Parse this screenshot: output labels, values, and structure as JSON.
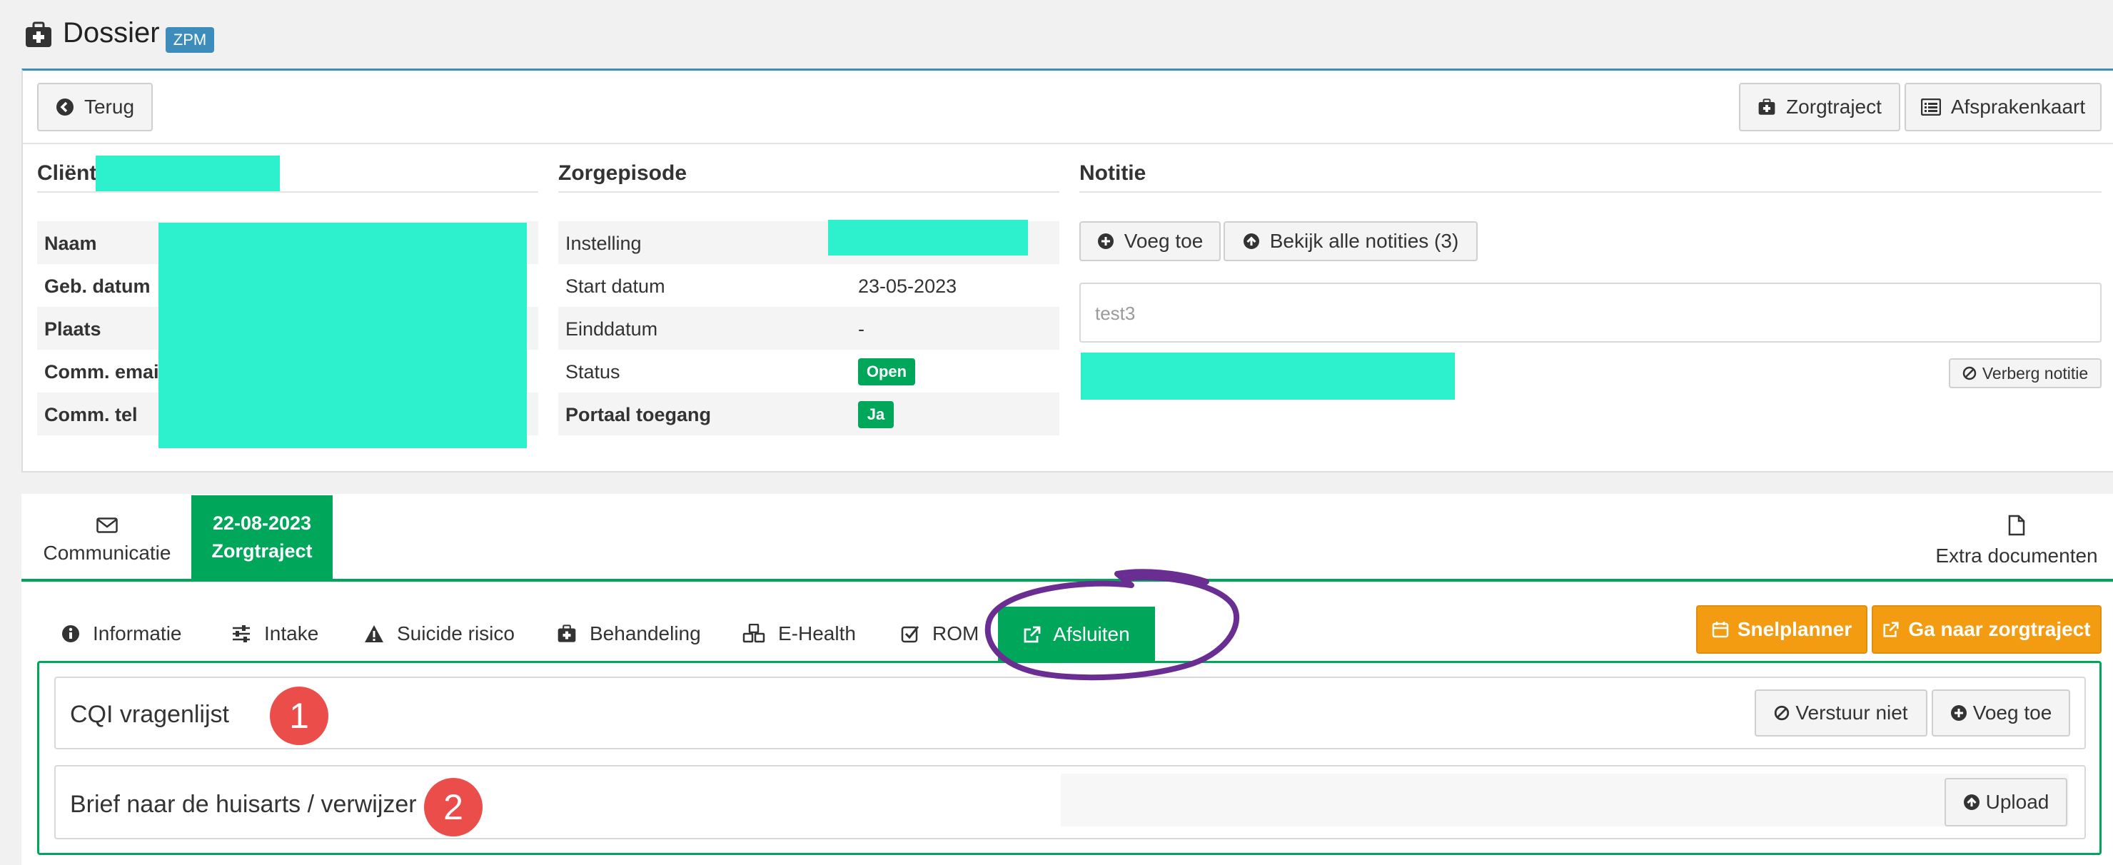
{
  "header": {
    "title": "Dossier",
    "badge": "ZPM"
  },
  "toolbar": {
    "back_label": "Terug",
    "zorgtraject_label": "Zorgtraject",
    "afspraken_label": "Afsprakenkaart"
  },
  "client": {
    "heading": "Cliënt",
    "fields": [
      {
        "label": "Naam"
      },
      {
        "label": "Geb. datum"
      },
      {
        "label": "Plaats"
      },
      {
        "label": "Comm. email"
      },
      {
        "label": "Comm. tel"
      }
    ]
  },
  "episode": {
    "heading": "Zorgepisode",
    "rows": [
      {
        "label": "Instelling",
        "value": ""
      },
      {
        "label": "Start datum",
        "value": "23-05-2023"
      },
      {
        "label": "Einddatum",
        "value": "-"
      },
      {
        "label": "Status",
        "value": "Open"
      },
      {
        "label": "Portaal toegang",
        "value": "Ja"
      }
    ]
  },
  "note": {
    "heading": "Notitie",
    "add_label": "Voeg toe",
    "view_all_label": "Bekijk alle notities (3)",
    "text": "test3",
    "hide_label": "Verberg notitie"
  },
  "tabs": [
    {
      "label": "Communicatie",
      "icon": "envelope-icon"
    },
    {
      "date": "22-08-2023",
      "label": "Zorgtraject",
      "active": true
    },
    {
      "label": "Extra documenten",
      "icon": "file-icon"
    }
  ],
  "subtabs": [
    {
      "label": "Informatie",
      "icon": "info-icon"
    },
    {
      "label": "Intake",
      "icon": "sliders-icon"
    },
    {
      "label": "Suicide risico",
      "icon": "warning-icon"
    },
    {
      "label": "Behandeling",
      "icon": "medkit-icon"
    },
    {
      "label": "E-Health",
      "icon": "cubes-icon"
    },
    {
      "label": "ROM",
      "icon": "check-square-icon"
    },
    {
      "label": "Afsluiten",
      "icon": "external-link-icon",
      "active": true
    }
  ],
  "actions": {
    "snelplanner_label": "Snelplanner",
    "goto_label": "Ga naar zorgtraject"
  },
  "items": [
    {
      "title": "CQI vragenlijst",
      "marker": "1",
      "btn1": "Verstuur niet",
      "btn2": "Voeg toe"
    },
    {
      "title": "Brief naar de huisarts / verwijzer",
      "marker": "2",
      "btn1": "Upload"
    }
  ],
  "colors": {
    "accent_green": "#00a65a",
    "orange": "#f39c12",
    "badge_blue": "#3c8dbc",
    "highlight_circle": "#6a2d91",
    "marker_red": "#ea4d4a",
    "redaction": "#2cf1cc"
  }
}
